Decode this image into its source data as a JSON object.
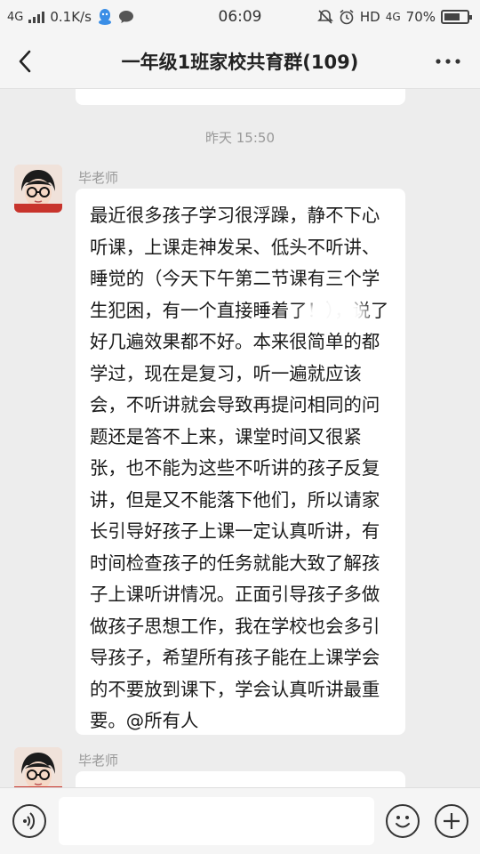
{
  "status_bar": {
    "network": "4G",
    "speed": "0.1K/s",
    "time": "06:09",
    "hd_label": "HD",
    "network_right": "4G",
    "battery": "70%",
    "battery_level": 0.7
  },
  "header": {
    "title": "一年级1班家校共育群(109)"
  },
  "chat": {
    "timestamp": "昨天 15:50",
    "messages": [
      {
        "sender": "毕老师",
        "text": "最近很多孩子学习很浮躁，静不下心听课，上课走神发呆、低头不听讲、睡觉的（今天下午第二节课有三个学生犯困，有一个直接睡着了！），说了好几遍效果都不好。本来很简单的都学过，现在是复习，听一遍就应该会，不听讲就会导致再提问相同的问题还是答不上来，课堂时间又很紧张，也不能为这些不听讲的孩子反复讲，但是又不能落下他们，所以请家长引导好孩子上课一定认真听讲，有时间检查孩子的任务就能大致了解孩子上课听讲情况。正面引导孩子多做做孩子思想工作，我在学校也会多引导孩子，希望所有孩子能在上课学会的不要放到课下，学会认真听讲最重要。@所有人"
      },
      {
        "sender": "毕老师",
        "text": ""
      }
    ]
  },
  "input": {
    "placeholder": "",
    "value": ""
  },
  "colors": {
    "background": "#ededed",
    "bubble": "#ffffff",
    "text": "#1a1a1a",
    "meta": "#999999"
  }
}
